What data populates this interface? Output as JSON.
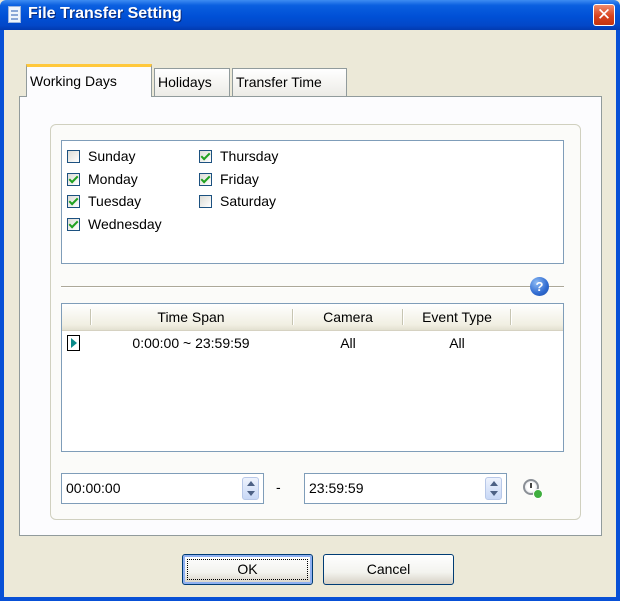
{
  "window": {
    "title": "File Transfer Setting",
    "close_glyph": "✕"
  },
  "tabs": [
    {
      "label": "Working Days",
      "active": true
    },
    {
      "label": "Holidays",
      "active": false
    },
    {
      "label": "Transfer Time",
      "active": false
    }
  ],
  "days": [
    {
      "label": "Sunday",
      "checked": false
    },
    {
      "label": "Monday",
      "checked": true
    },
    {
      "label": "Tuesday",
      "checked": true
    },
    {
      "label": "Wednesday",
      "checked": true
    },
    {
      "label": "Thursday",
      "checked": true
    },
    {
      "label": "Friday",
      "checked": true
    },
    {
      "label": "Saturday",
      "checked": false
    }
  ],
  "help_glyph": "?",
  "grid": {
    "columns": [
      "Time Span",
      "Camera",
      "Event Type"
    ],
    "rows": [
      {
        "time_span": "0:00:00 ~ 23:59:59",
        "camera": "All",
        "event_type": "All"
      }
    ]
  },
  "time_range": {
    "start": "00:00:00",
    "separator": "-",
    "end": "23:59:59"
  },
  "buttons": {
    "ok": "OK",
    "cancel": "Cancel"
  },
  "icons": [
    "document-icon",
    "close-icon",
    "help-icon",
    "row-indicator-icon",
    "spin-up-icon",
    "spin-down-icon",
    "clock-add-icon"
  ],
  "colors": {
    "titlebar": "#0050d6",
    "close": "#d8431e",
    "active_tab_accent": "#ffc83c",
    "checkmark": "#21a121"
  }
}
